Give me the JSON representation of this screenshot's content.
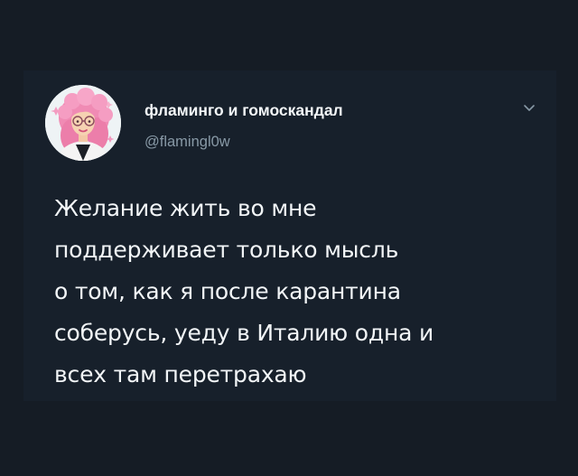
{
  "tweet": {
    "display_name": "фламинго и гомоскандал",
    "handle": "@flamingl0w",
    "menu_icon": "chevron-down-icon",
    "avatar_icon": "pink-haired-woman-avatar",
    "text": "Желание жить во мне\nподдерживает только мысль\nо том, как я после карантина\nсоберусь, уеду в Италию одна и\nвсех там перетрахаю"
  },
  "colors": {
    "background": "#151c25",
    "card": "#17202b",
    "primary_text": "#f2f5f7",
    "secondary_text": "#8899a6"
  }
}
